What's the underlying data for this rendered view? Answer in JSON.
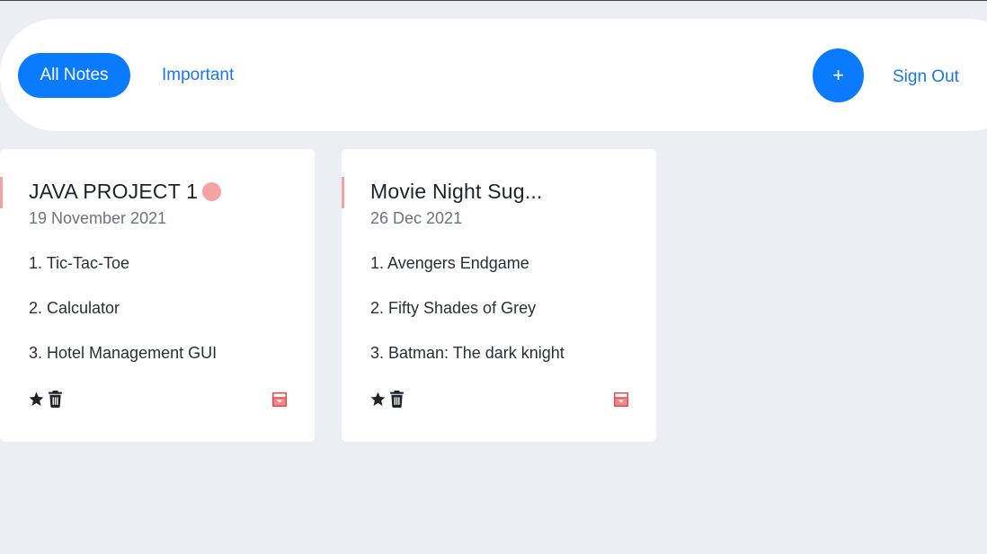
{
  "nav": {
    "all_notes": "All Notes",
    "important": "Important",
    "add": "+",
    "sign_out": "Sign Out"
  },
  "notes": [
    {
      "title": "JAVA PROJECT 1",
      "date": "19 November 2021",
      "lines": [
        "1. Tic-Tac-Toe",
        "2. Calculator",
        "3. Hotel Management GUI"
      ],
      "has_dot": true
    },
    {
      "title": "Movie Night Sug...",
      "date": "26 Dec 2021",
      "lines": [
        "1. Avengers Endgame",
        "2. Fifty Shades of Grey",
        "3. Batman: The dark knight"
      ],
      "has_dot": false
    }
  ],
  "icons": [
    "star-icon",
    "trash-icon",
    "archive-icon"
  ],
  "colors": {
    "primary": "#0a7bff",
    "link": "#1a78e6",
    "accent": "#f4a3a3",
    "archive": "#e84c4c",
    "background": "#ebeef3"
  }
}
